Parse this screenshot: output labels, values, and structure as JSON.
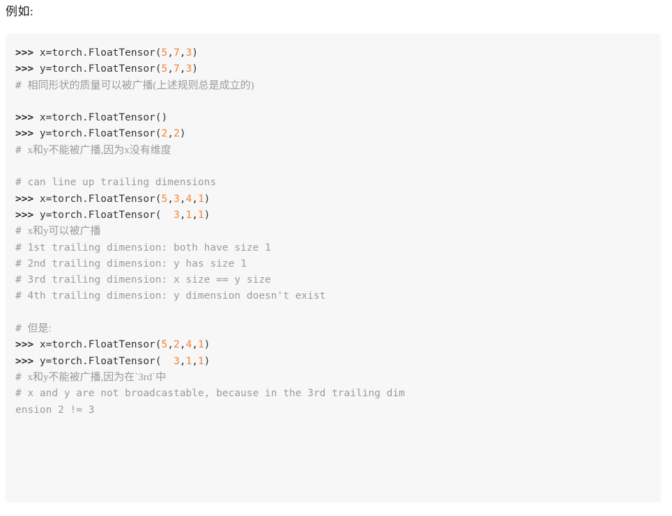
{
  "intro": {
    "text": "例如:"
  },
  "code_block": {
    "language": "python-console",
    "background_color": "#f7f7f7",
    "prompt_symbol": ">>>",
    "comment_symbol": "#",
    "colors": {
      "number": "#f08437",
      "comment": "#9b9b9b",
      "code": "#333333",
      "background": "#f7f7f7"
    },
    "lines": [
      {
        "type": "code",
        "text": ">>> x=torch.FloatTensor(5,7,3)",
        "tokens": [
          {
            "t": "prompt",
            "v": ">>> "
          },
          {
            "t": "plain",
            "v": "x=torch.FloatTensor("
          },
          {
            "t": "num",
            "v": "5"
          },
          {
            "t": "plain",
            "v": ","
          },
          {
            "t": "num",
            "v": "7"
          },
          {
            "t": "plain",
            "v": ","
          },
          {
            "t": "num",
            "v": "3"
          },
          {
            "t": "plain",
            "v": ")"
          }
        ]
      },
      {
        "type": "code",
        "text": ">>> y=torch.FloatTensor(5,7,3)",
        "tokens": [
          {
            "t": "prompt",
            "v": ">>> "
          },
          {
            "t": "plain",
            "v": "y=torch.FloatTensor("
          },
          {
            "t": "num",
            "v": "5"
          },
          {
            "t": "plain",
            "v": ","
          },
          {
            "t": "num",
            "v": "7"
          },
          {
            "t": "plain",
            "v": ","
          },
          {
            "t": "num",
            "v": "3"
          },
          {
            "t": "plain",
            "v": ")"
          }
        ]
      },
      {
        "type": "comment-cjk",
        "text": "# 相同形状的质量可以被广播(上述规则总是成立的)",
        "tokens": [
          {
            "t": "comment",
            "v": "# "
          },
          {
            "t": "cjk",
            "v": "相同形状的质量可以被广播(上述规则总是成立的)"
          }
        ]
      },
      {
        "type": "blank",
        "text": ""
      },
      {
        "type": "code",
        "text": ">>> x=torch.FloatTensor()",
        "tokens": [
          {
            "t": "prompt",
            "v": ">>> "
          },
          {
            "t": "plain",
            "v": "x=torch.FloatTensor()"
          }
        ]
      },
      {
        "type": "code",
        "text": ">>> y=torch.FloatTensor(2,2)",
        "tokens": [
          {
            "t": "prompt",
            "v": ">>> "
          },
          {
            "t": "plain",
            "v": "y=torch.FloatTensor("
          },
          {
            "t": "num",
            "v": "2"
          },
          {
            "t": "plain",
            "v": ","
          },
          {
            "t": "num",
            "v": "2"
          },
          {
            "t": "plain",
            "v": ")"
          }
        ]
      },
      {
        "type": "comment-cjk",
        "text": "# x和y不能被广播,因为x没有维度",
        "tokens": [
          {
            "t": "comment",
            "v": "# "
          },
          {
            "t": "cjk",
            "v": "x和y不能被广播,因为x没有维度"
          }
        ]
      },
      {
        "type": "blank",
        "text": ""
      },
      {
        "type": "comment",
        "text": "# can line up trailing dimensions",
        "tokens": [
          {
            "t": "comment",
            "v": "# can line up trailing dimensions"
          }
        ]
      },
      {
        "type": "code",
        "text": ">>> x=torch.FloatTensor(5,3,4,1)",
        "tokens": [
          {
            "t": "prompt",
            "v": ">>> "
          },
          {
            "t": "plain",
            "v": "x=torch.FloatTensor("
          },
          {
            "t": "num",
            "v": "5"
          },
          {
            "t": "plain",
            "v": ","
          },
          {
            "t": "num",
            "v": "3"
          },
          {
            "t": "plain",
            "v": ","
          },
          {
            "t": "num",
            "v": "4"
          },
          {
            "t": "plain",
            "v": ","
          },
          {
            "t": "num",
            "v": "1"
          },
          {
            "t": "plain",
            "v": ")"
          }
        ]
      },
      {
        "type": "code",
        "text": ">>> y=torch.FloatTensor(  3,1,1)",
        "tokens": [
          {
            "t": "prompt",
            "v": ">>> "
          },
          {
            "t": "plain",
            "v": "y=torch.FloatTensor(  "
          },
          {
            "t": "num",
            "v": "3"
          },
          {
            "t": "plain",
            "v": ","
          },
          {
            "t": "num",
            "v": "1"
          },
          {
            "t": "plain",
            "v": ","
          },
          {
            "t": "num",
            "v": "1"
          },
          {
            "t": "plain",
            "v": ")"
          }
        ]
      },
      {
        "type": "comment-cjk",
        "text": "# x和y可以被广播",
        "tokens": [
          {
            "t": "comment",
            "v": "# "
          },
          {
            "t": "cjk",
            "v": "x和y可以被广播"
          }
        ]
      },
      {
        "type": "comment",
        "text": "# 1st trailing dimension: both have size 1",
        "tokens": [
          {
            "t": "comment",
            "v": "# 1st trailing dimension: both have size 1"
          }
        ]
      },
      {
        "type": "comment",
        "text": "# 2nd trailing dimension: y has size 1",
        "tokens": [
          {
            "t": "comment",
            "v": "# 2nd trailing dimension: y has size 1"
          }
        ]
      },
      {
        "type": "comment",
        "text": "# 3rd trailing dimension: x size == y size",
        "tokens": [
          {
            "t": "comment",
            "v": "# 3rd trailing dimension: x size == y size"
          }
        ]
      },
      {
        "type": "comment",
        "text": "# 4th trailing dimension: y dimension doesn't exist",
        "tokens": [
          {
            "t": "comment",
            "v": "# 4th trailing dimension: y dimension doesn't exist"
          }
        ]
      },
      {
        "type": "blank",
        "text": ""
      },
      {
        "type": "comment-cjk",
        "text": "# 但是:",
        "tokens": [
          {
            "t": "comment",
            "v": "# "
          },
          {
            "t": "cjk",
            "v": "但是:"
          }
        ]
      },
      {
        "type": "code",
        "text": ">>> x=torch.FloatTensor(5,2,4,1)",
        "tokens": [
          {
            "t": "prompt",
            "v": ">>> "
          },
          {
            "t": "plain",
            "v": "x=torch.FloatTensor("
          },
          {
            "t": "num",
            "v": "5"
          },
          {
            "t": "plain",
            "v": ","
          },
          {
            "t": "num",
            "v": "2"
          },
          {
            "t": "plain",
            "v": ","
          },
          {
            "t": "num",
            "v": "4"
          },
          {
            "t": "plain",
            "v": ","
          },
          {
            "t": "num",
            "v": "1"
          },
          {
            "t": "plain",
            "v": ")"
          }
        ]
      },
      {
        "type": "code",
        "text": ">>> y=torch.FloatTensor(  3,1,1)",
        "tokens": [
          {
            "t": "prompt",
            "v": ">>> "
          },
          {
            "t": "plain",
            "v": "y=torch.FloatTensor(  "
          },
          {
            "t": "num",
            "v": "3"
          },
          {
            "t": "plain",
            "v": ","
          },
          {
            "t": "num",
            "v": "1"
          },
          {
            "t": "plain",
            "v": ","
          },
          {
            "t": "num",
            "v": "1"
          },
          {
            "t": "plain",
            "v": ")"
          }
        ]
      },
      {
        "type": "comment-cjk",
        "text": "# x和y不能被广播,因为在`3rd`中",
        "tokens": [
          {
            "t": "comment",
            "v": "# "
          },
          {
            "t": "cjk",
            "v": "x和y不能被广播,因为在`3rd`中"
          }
        ]
      },
      {
        "type": "comment",
        "text": "# x and y are not broadcastable, because in the 3rd trailing dim",
        "tokens": [
          {
            "t": "comment",
            "v": "# x and y are not broadcastable, because in the 3rd trailing dim"
          }
        ]
      },
      {
        "type": "comment",
        "text": "ension 2 != 3",
        "tokens": [
          {
            "t": "comment",
            "v": "ension 2 != 3"
          }
        ]
      }
    ]
  }
}
